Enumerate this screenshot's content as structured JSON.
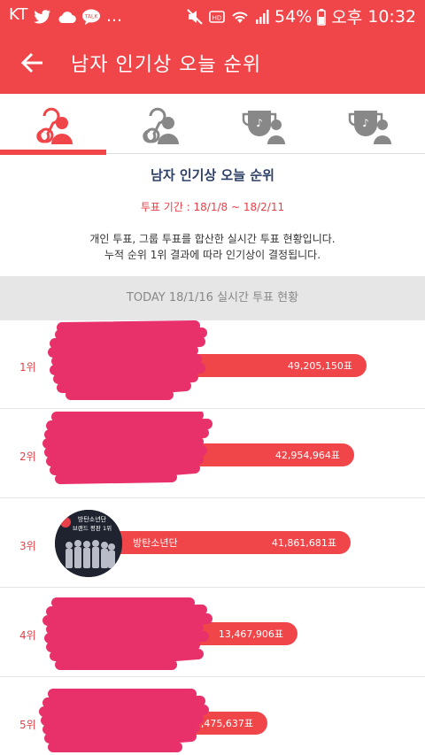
{
  "status_bar": {
    "carrier": "KT",
    "battery": "54%",
    "ampm": "오후",
    "time": "10:32"
  },
  "app_bar": {
    "title": "남자 인기상 오늘 순위"
  },
  "tabs": [
    {
      "icon": "male-popularity-icon",
      "active": true
    },
    {
      "icon": "female-popularity-icon",
      "active": false
    },
    {
      "icon": "trophy-male-icon",
      "active": false
    },
    {
      "icon": "trophy-female-icon",
      "active": false
    }
  ],
  "info": {
    "heading": "남자 인기상 오늘 순위",
    "period": "투표 기간 : 18/1/8 ~ 18/2/11",
    "desc_line1": "개인 투표, 그룹 투표를 합산한 실시간 투표 현황입니다.",
    "desc_line2": "누적 순위 1위 결과에 따라 인기상이 결정됩니다."
  },
  "today": {
    "label": "TODAY 18/1/16 실시간 투표 현황"
  },
  "rankings": [
    {
      "rank": "1위",
      "name": "",
      "votes": "49,205,150표",
      "value": 49205150
    },
    {
      "rank": "2위",
      "name": "",
      "votes": "42,954,964표",
      "value": 42954964
    },
    {
      "rank": "3위",
      "name": "방탄소년단",
      "votes": "41,861,681표",
      "value": 41861681,
      "avatar_caption_line1": "방탄소년단",
      "avatar_caption_line2": "브랜드 평판 1위"
    },
    {
      "rank": "4위",
      "name": "",
      "votes": "13,467,906표",
      "value": 13467906
    },
    {
      "rank": "5위",
      "name": "",
      "votes": "2,475,637표",
      "value": 2475637
    }
  ],
  "colors": {
    "accent": "#f0464a",
    "scribble": "#e8306a",
    "title_blue": "#2e4066"
  }
}
